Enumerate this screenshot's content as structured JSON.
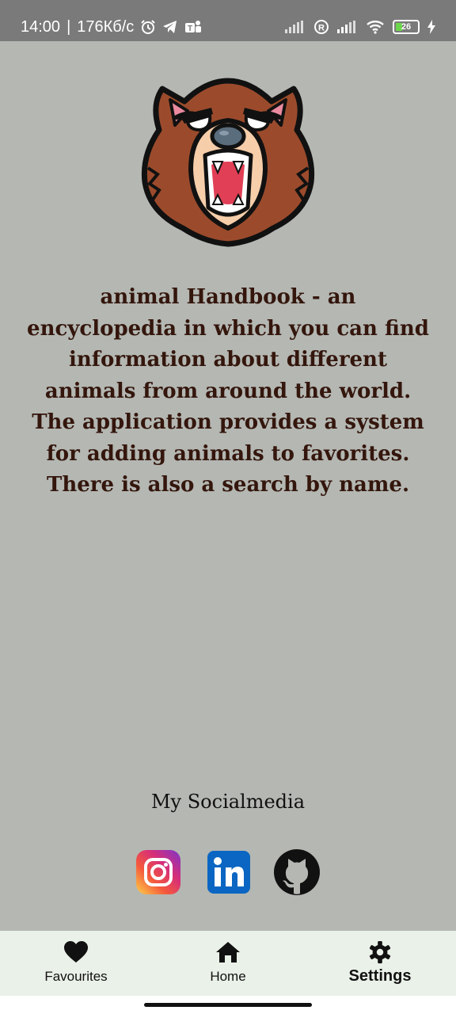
{
  "status_bar": {
    "time": "14:00",
    "separator": "|",
    "network_speed": "176Кб/c",
    "battery": "26",
    "icons": [
      "alarm-icon",
      "telegram-icon",
      "teams-icon",
      "signal-icon",
      "registered-icon",
      "signal-icon",
      "wifi-icon",
      "battery-icon",
      "charging-icon"
    ]
  },
  "logo": {
    "icon": "bear-head-icon"
  },
  "description": "animal Handbook - an encyclopedia in which you can find information about different animals from around the world. The application provides a system for adding animals to favorites. There is also a search by name.",
  "social": {
    "title": "My Socialmedia",
    "links": [
      {
        "name": "Instagram",
        "icon": "instagram-icon"
      },
      {
        "name": "LinkedIn",
        "icon": "linkedin-icon"
      },
      {
        "name": "GitHub",
        "icon": "github-icon"
      }
    ]
  },
  "bottom_nav": {
    "active": "Settings",
    "items": [
      {
        "label": "Favourites",
        "icon": "heart-icon"
      },
      {
        "label": "Home",
        "icon": "home-icon"
      },
      {
        "label": "Settings",
        "icon": "gear-icon"
      }
    ]
  },
  "colors": {
    "background": "#b4b7b2",
    "status_bar": "#7a7a7a",
    "text_dark_brown": "#34160d",
    "nav_background": "#eaf1e8",
    "bear_fur": "#9b4b2c",
    "bear_muzzle": "#f6ceaa",
    "bear_mouth": "#e03f55"
  }
}
